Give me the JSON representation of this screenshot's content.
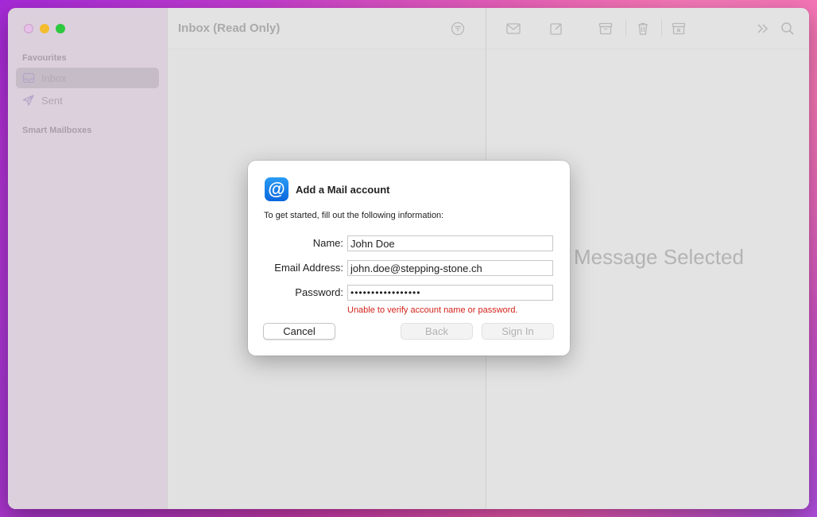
{
  "window": {
    "sidebar": {
      "sections": [
        {
          "title": "Favourites"
        },
        {
          "title": "Smart Mailboxes"
        }
      ],
      "items": [
        {
          "label": "Inbox",
          "icon": "inbox-icon"
        },
        {
          "label": "Sent",
          "icon": "paper-plane-icon"
        }
      ]
    },
    "list": {
      "title": "Inbox (Read Only)"
    },
    "detail": {
      "empty_text": "Message Selected"
    },
    "toolbar": [
      "filter-icon",
      "envelope-icon",
      "compose-icon",
      "archive-icon",
      "trash-icon",
      "junk-icon",
      "chevron-double-right-icon",
      "search-icon"
    ]
  },
  "dialog": {
    "title": "Add a Mail account",
    "icon": "at-sign-icon",
    "icon_glyph": "@",
    "instructions": "To get started, fill out the following information:",
    "fields": {
      "name": {
        "label": "Name:",
        "value": "John Doe"
      },
      "email": {
        "label": "Email Address:",
        "value": "john.doe@stepping-stone.ch"
      },
      "password": {
        "label": "Password:",
        "value": "•••••••••••••••••"
      }
    },
    "error": "Unable to verify account name or password.",
    "buttons": {
      "cancel": "Cancel",
      "back": "Back",
      "sign_in": "Sign In"
    }
  },
  "colors": {
    "accent": "#0a66dd",
    "error": "#d2231b"
  }
}
